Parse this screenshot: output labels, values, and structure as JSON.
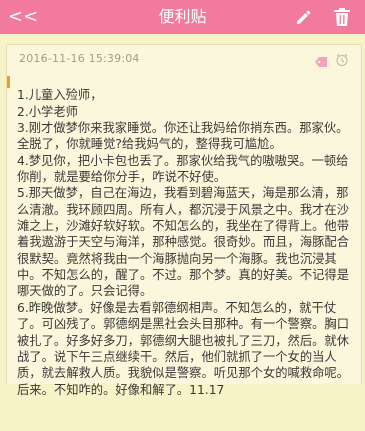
{
  "header": {
    "back_label": "<<",
    "title": "便利贴",
    "edit_icon": "pencil-icon",
    "delete_icon": "trash-icon",
    "bar_color": "#f27a9e"
  },
  "note": {
    "timestamp": "2016-11-16 15:39:04",
    "tag_icon": "tag-icon",
    "reminder_icon": "alarm-clock-icon",
    "lines": [
      "1.儿童入殓师，",
      "2.小学老师",
      "3.刚才做梦你来我家睡觉。你还让我妈给你捎东西。那家伙。全脱了，你就睡觉?给我妈气的，整得我可尴尬。",
      "4.梦见你，把小卡包也丢了。那家伙给我气的嗷嗷哭。一顿给你削，就是要给你分手，咋说不好使。",
      "5.那天做梦，自己在海边，我看到碧海蓝天，海是那么清，那么清澈。我环顾四周。所有人，都沉浸于风景之中。我才在沙滩之上，沙滩好软好软。不知怎么的，我坐在了得背上。他带着我遨游于天空与海洋，那种感觉。很奇妙。而且，海豚配合很默契。竟然将我由一个海豚抛向另一个海豚。我也沉浸其中。不知怎么的，醒了。不过。那个梦。真的好美。不记得是哪天做的了。只会记得。",
      "6.昨晚做梦。好像是去看郭德纲相声。不知怎么的，就干仗了。可凶残了。郭德纲是黑社会头目那种。有一个警察。胸口被扎了。好多好多刀，郭德纲大腿也被扎了三刀，然后。就休战了。说下午三点继续干。然后，他们就抓了一个女的当人质，就去解救人质。我貌似是警察。听见那个女的喊救命呢。后来。不知咋的。好像和解了。11.17"
    ]
  }
}
